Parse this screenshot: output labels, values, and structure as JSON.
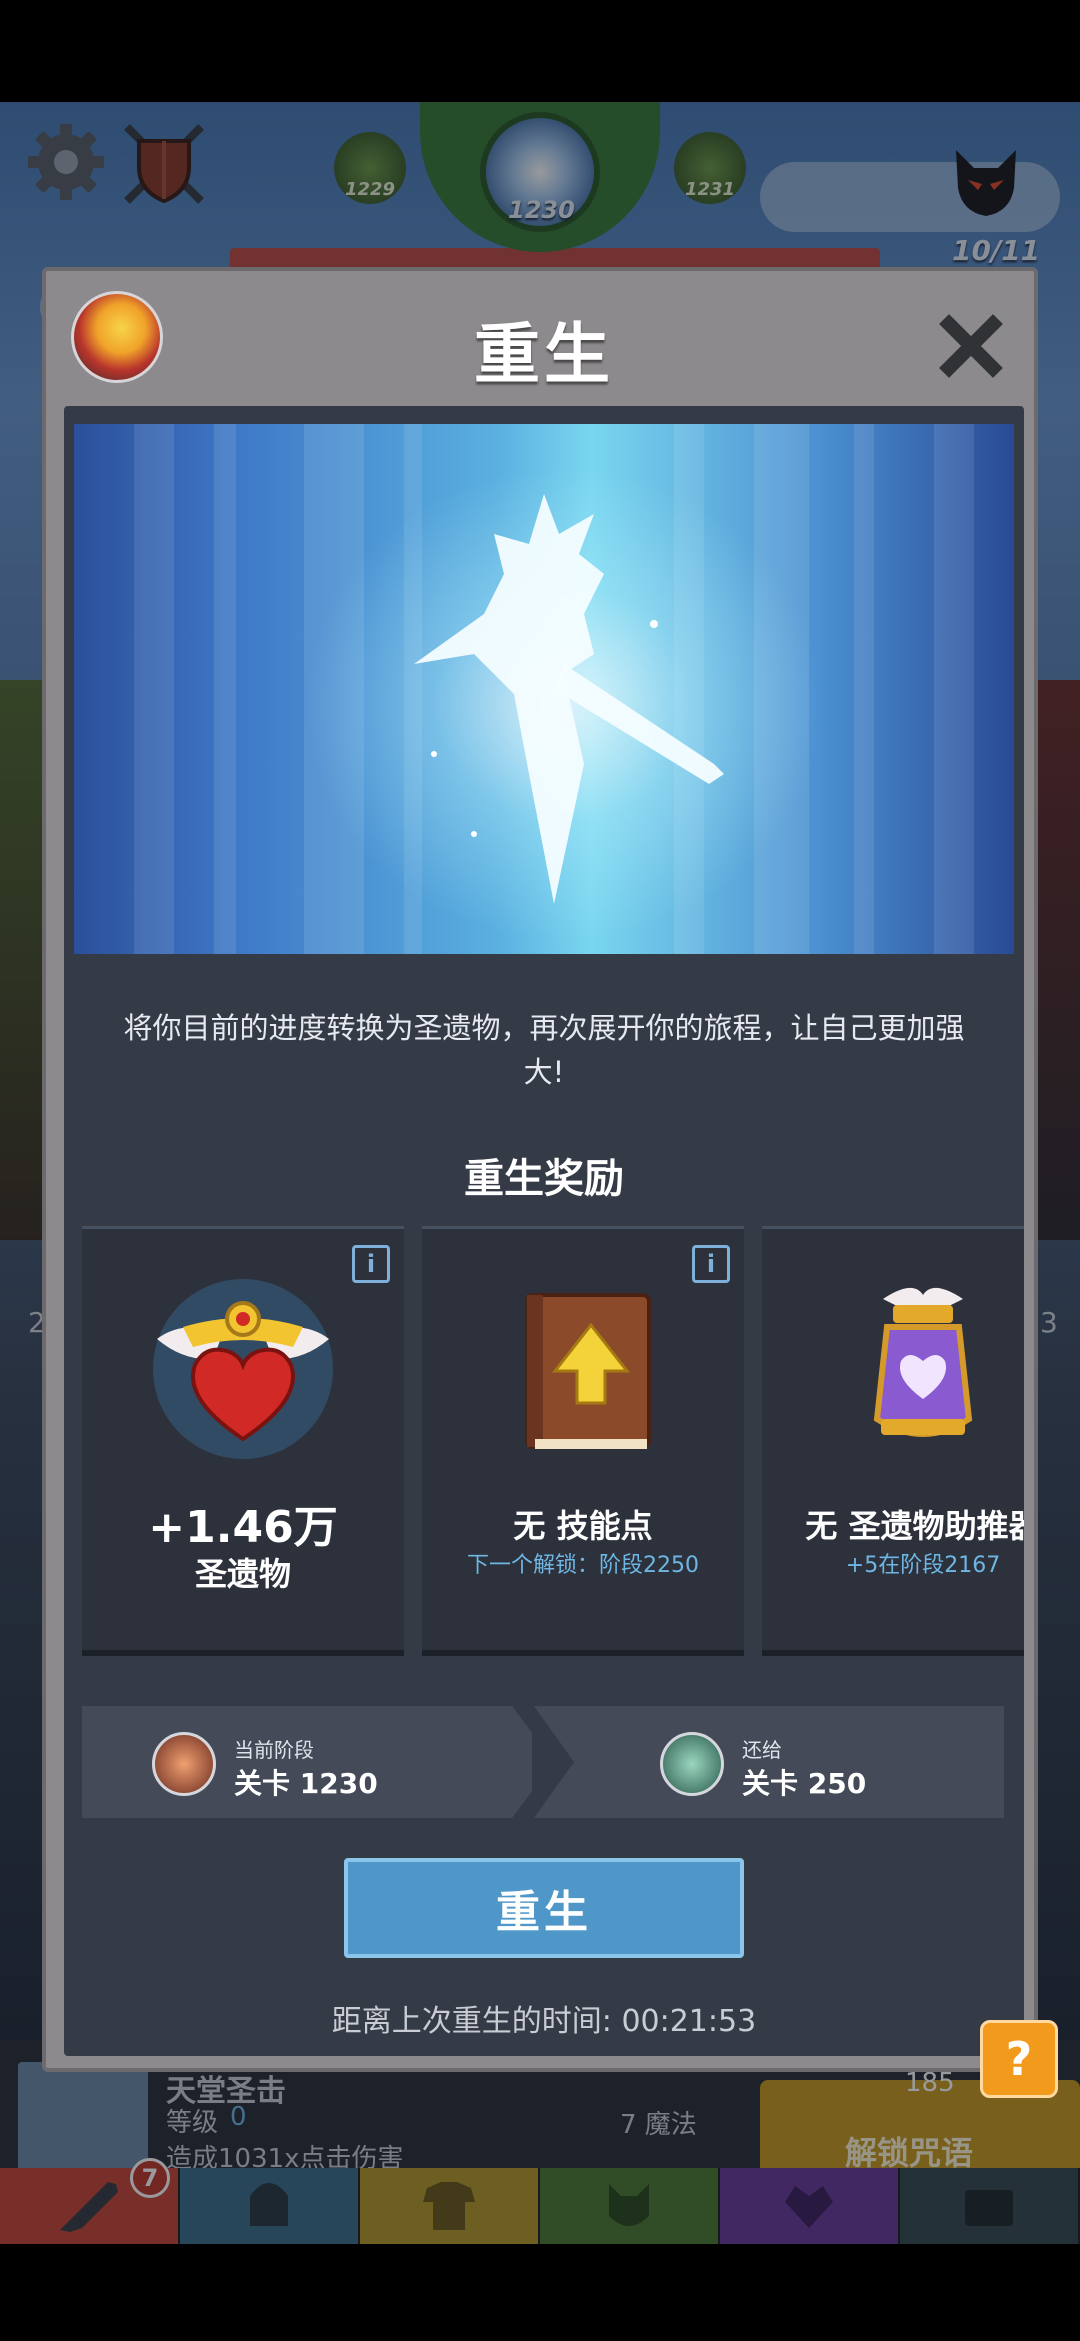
{
  "hud": {
    "stage_prev": "1229",
    "stage_current": "1230",
    "stage_next": "1231",
    "boss_count": "10/11",
    "icons": [
      "gear-icon",
      "shield-swords-icon",
      "boss-head-icon"
    ]
  },
  "modal": {
    "title": "重生",
    "description": "将你目前的进度转换为圣遗物，再次展开你的旅程，让自己更加强大!",
    "rewards_title": "重生奖励",
    "rewards": [
      {
        "main": "+1.46万",
        "sub_label": "圣遗物",
        "note": "",
        "icon": "heart-relic-icon"
      },
      {
        "main": "无 技能点",
        "sub_label": "",
        "note": "下一个解锁：阶段2250",
        "icon": "skill-book-icon"
      },
      {
        "main": "无 圣遗物助推器",
        "sub_label": "",
        "note": "+5在阶段2167",
        "icon": "relic-booster-icon"
      }
    ],
    "info_label": "i",
    "current_stage": {
      "caption": "当前阶段",
      "value": "关卡 1230"
    },
    "return_stage": {
      "caption": "还给",
      "value": "关卡 250"
    },
    "rebirth_button": "重生",
    "timer": "距离上次重生的时间: 00:21:53"
  },
  "background": {
    "skill_name": "天堂圣击",
    "skill_level_label": "等级",
    "skill_level_value": "0",
    "skill_desc": "造成1031x点击伤害",
    "mana": "7 魔法",
    "cost": "185",
    "unlock_label": "解锁咒语",
    "tab_badge": "7",
    "side_text_left": "2",
    "side_text_right": "3"
  },
  "help_label": "?",
  "colors": {
    "modal_frame": "#8d8a8e",
    "modal_body": "#353a47",
    "card_bg": "#2c313c",
    "accent_blue": "#4f97c9",
    "note_blue": "#6fb6e4",
    "help_orange": "#f29a1c",
    "tab_colors": [
      "#c9473a",
      "#3e6e8a",
      "#b59a2c",
      "#4f7a34",
      "#6a3c9a",
      "#3a4a52"
    ]
  }
}
